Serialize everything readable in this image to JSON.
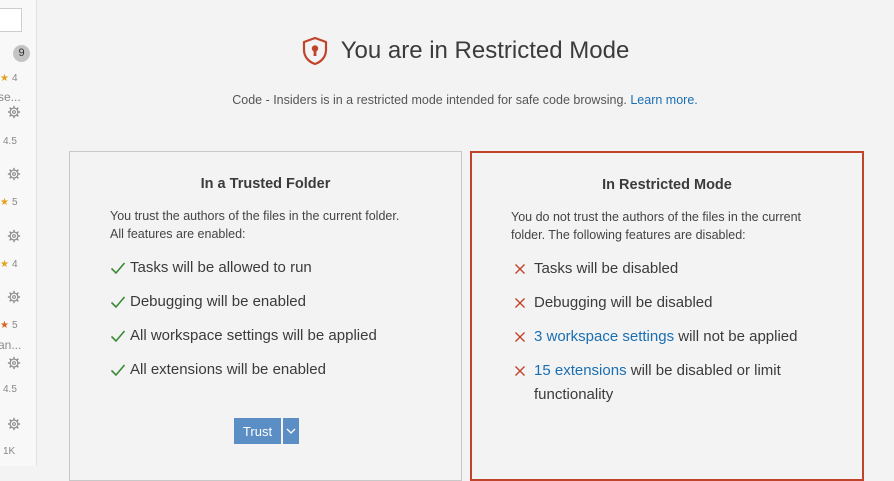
{
  "sidebar": {
    "badge": "9",
    "ratings": [
      "4",
      "5",
      "4",
      "5"
    ],
    "plain_values": [
      "4.5",
      "4.5",
      "1K"
    ],
    "snippets": [
      "se...",
      "an..."
    ]
  },
  "header": {
    "title": "You are in Restricted Mode",
    "subtitle_text": "Code - Insiders is in a restricted mode intended for safe code browsing.",
    "learn_more": "Learn more."
  },
  "trusted": {
    "title": "In a Trusted Folder",
    "desc_line1": "You trust the authors of the files in the current folder.",
    "desc_line2": "All features are enabled:",
    "items": [
      "Tasks will be allowed to run",
      "Debugging will be enabled",
      "All workspace settings will be applied",
      "All extensions will be enabled"
    ],
    "trust_label": "Trust"
  },
  "restricted": {
    "title": "In Restricted Mode",
    "desc_line1": "You do not trust the authors of the files in the current",
    "desc_line2": "folder. The following features are disabled:",
    "item1": "Tasks will be disabled",
    "item2": "Debugging will be disabled",
    "item3_link": "3 workspace settings",
    "item3_rest": " will not be applied",
    "item4_link": "15 extensions",
    "item4_rest": " will be disabled or limit functionality"
  },
  "colors": {
    "accent_red": "#c0432b",
    "check_green": "#388a34",
    "link_blue": "#1a6fb3",
    "button_blue": "#5b8ec4"
  }
}
